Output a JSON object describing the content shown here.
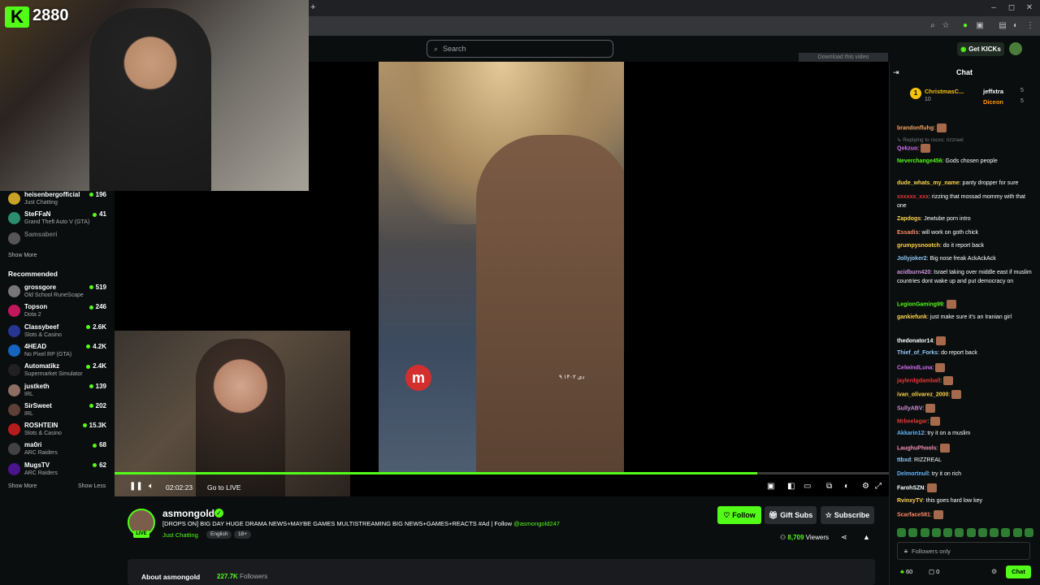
{
  "browser": {
    "window_controls": [
      "–",
      "◻",
      "✕"
    ]
  },
  "header": {
    "search_placeholder": "Search",
    "get_kicks": "Get KICKs"
  },
  "overlay": {
    "kick_logo": "K",
    "kick_count": "2880",
    "download_text": "Download this video"
  },
  "sidebar": {
    "following": [
      {
        "name": "heisenbergofficial",
        "category": "Just Chatting",
        "viewers": "196",
        "color": "#c9a227"
      },
      {
        "name": "SteFFaN",
        "category": "Grand Theft Auto V (GTA)",
        "viewers": "41",
        "color": "#2b8c6e"
      },
      {
        "name": "Samsaberi",
        "category": "",
        "viewers": "",
        "color": "#555"
      }
    ],
    "show_more_1": "Show More",
    "recommended_label": "Recommended",
    "recommended": [
      {
        "name": "grossgore",
        "category": "Old School RuneScape",
        "viewers": "519",
        "color": "#777"
      },
      {
        "name": "Topson",
        "category": "Dota 2",
        "viewers": "246",
        "color": "#c2185b"
      },
      {
        "name": "Classybeef",
        "category": "Slots & Casino",
        "viewers": "2.6K",
        "color": "#283593"
      },
      {
        "name": "4HEAD",
        "category": "No Pixel RP (GTA)",
        "viewers": "4.2K",
        "color": "#1565c0"
      },
      {
        "name": "Automatikz",
        "category": "Supermarket Simulator",
        "viewers": "2.4K",
        "color": "#212121"
      },
      {
        "name": "justketh",
        "category": "IRL",
        "viewers": "139",
        "color": "#8d6e63"
      },
      {
        "name": "SirSweet",
        "category": "IRL",
        "viewers": "202",
        "color": "#5d4037"
      },
      {
        "name": "ROSHTEIN",
        "category": "Slots & Casino",
        "viewers": "15.3K",
        "color": "#b71c1c"
      },
      {
        "name": "ma0ri",
        "category": "ARC Raiders",
        "viewers": "68",
        "color": "#424242"
      },
      {
        "name": "MugsTV",
        "category": "ARC Raiders",
        "viewers": "62",
        "color": "#4a148c"
      }
    ],
    "show_more_2": "Show More",
    "show_less": "Show Less"
  },
  "player": {
    "time": "02:02:23",
    "go_to_live": "Go to LIVE",
    "progress": 0.83,
    "clip_logo": "m",
    "clip_date": "۹ دی ۱۴۰۲"
  },
  "stream": {
    "live": "LIVE",
    "name": "asmongold",
    "title_main": "[DROPS ON] BIG DAY HUGE DRAMA NEWS+MAYBE GAMES MULTISTREAMING BIG NEWS+GAMES+REACTS #Ad | Follow ",
    "title_link": "@asmongold247",
    "category": "Just Chatting",
    "tags": [
      "English",
      "18+"
    ],
    "follow": "Follow",
    "gift_subs": "Gift Subs",
    "subscribe": "Subscribe",
    "viewers": "8,709",
    "viewers_label": "Viewers",
    "about_title": "About asmongold",
    "followers_count": "227.7K",
    "followers_label": "Followers"
  },
  "chat": {
    "title": "Chat",
    "leaderboard": [
      {
        "rank": "1",
        "name": "ChristmasC...",
        "value": "10"
      },
      {
        "name": "jeffxtra",
        "value": "5"
      },
      {
        "name": "Diceon",
        "value": "5"
      }
    ],
    "messages": [
      {
        "user": "brandonfluhg",
        "text": "",
        "color": "#f4a261",
        "emote": true
      },
      {
        "user": "",
        "text": "Replying to rocxs: rizzrael",
        "color": "#777",
        "reply": true
      },
      {
        "user": "Qekzuo",
        "text": "",
        "color": "#d36ef3",
        "emote": true
      },
      {
        "user": "Neverchange456",
        "text": "Gods chosen people",
        "color": "#53fc18"
      },
      {
        "user": "dude_whats_my_name",
        "text": "panty dropper for sure",
        "color": "#ffd54f"
      },
      {
        "user": "xxxxxx_xxx",
        "text": "rizzing that mossad mommy with that one",
        "color": "#e53935"
      },
      {
        "user": "Zapdogs",
        "text": "Jewtube porn intro",
        "color": "#ffd54f"
      },
      {
        "user": "Essadis",
        "text": "will work on goth chick",
        "color": "#ff8a65"
      },
      {
        "user": "grumpysnootch",
        "text": "do it report back",
        "color": "#ffd54f"
      },
      {
        "user": "Jollyjoker2",
        "text": "Big nose freak AckAckAck",
        "color": "#90caf9"
      },
      {
        "user": "acidburn420",
        "text": "Israel taking over middle east if muslim countries dont wake up and put democracy on",
        "color": "#ce93d8"
      },
      {
        "user": "LegionGaming99",
        "text": "",
        "color": "#53fc18",
        "emote": true
      },
      {
        "user": "gankiefunk",
        "text": "just make sure it's an Iranian girl",
        "color": "#ffd54f"
      },
      {
        "user": "thedonator14",
        "text": "",
        "color": "#fff",
        "emote": true
      },
      {
        "user": "Thief_of_Forks",
        "text": "do report back",
        "color": "#90caf9"
      },
      {
        "user": "CelwindLuna",
        "text": "",
        "color": "#d36ef3",
        "emote": true
      },
      {
        "user": "jaylerdgdamball",
        "text": "",
        "color": "#e53935",
        "emote": true
      },
      {
        "user": "ivan_olivarez_2000",
        "text": "",
        "color": "#ffd54f",
        "emote": true
      },
      {
        "user": "SullyABV",
        "text": "",
        "color": "#ce93d8",
        "emote": true
      },
      {
        "user": "Mrbeelagar",
        "text": "",
        "color": "#e53935",
        "emote": true
      },
      {
        "user": "Akkarin12",
        "text": "try it on a muslim",
        "color": "#64b5f6"
      },
      {
        "user": "LaughuPhools",
        "text": "",
        "color": "#f48fb1",
        "emote": true
      },
      {
        "user": "ttbxd",
        "text": "RIZZREAL",
        "color": "#90caf9"
      },
      {
        "user": "Delmortnull",
        "text": "try it on rich",
        "color": "#64b5f6"
      },
      {
        "user": "FarohSZN",
        "text": "",
        "color": "#fff",
        "emote": true
      },
      {
        "user": "RvinxyTV",
        "text": "this goes hard low key",
        "color": "#ffd54f"
      },
      {
        "user": "Scarface581",
        "text": "",
        "color": "#ff8a65",
        "emote": true
      }
    ],
    "followers_only": "Followers only",
    "points": "60",
    "gifts": "0",
    "chat_button": "Chat"
  }
}
